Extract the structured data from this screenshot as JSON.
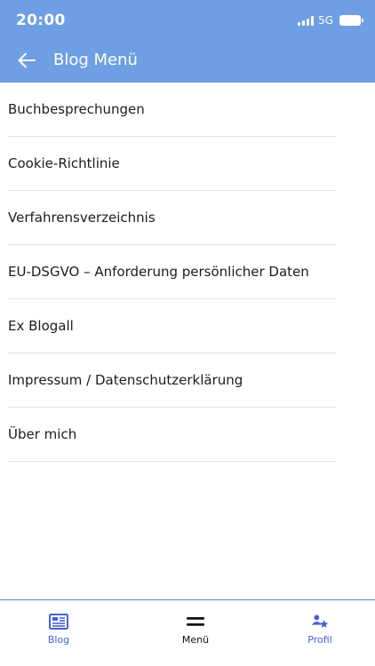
{
  "status": {
    "time": "20:00",
    "network": "5G"
  },
  "header": {
    "title": "Blog Menü",
    "back_icon": "arrow-left-icon"
  },
  "menu_items": [
    {
      "label": "Buchbesprechungen"
    },
    {
      "label": "Cookie-Richtlinie"
    },
    {
      "label": "Verfahrensverzeichnis"
    },
    {
      "label": "EU-DSGVO – Anforderung persönlicher Daten"
    },
    {
      "label": "Ex Blogall"
    },
    {
      "label": "Impressum / Datenschutzerklärung"
    },
    {
      "label": "Über mich"
    }
  ],
  "bottom_nav": {
    "blog": {
      "label": "Blog",
      "icon": "newspaper-icon"
    },
    "menu": {
      "label": "Menü",
      "icon": "menu-icon"
    },
    "profil": {
      "label": "Profil",
      "icon": "users-icon"
    }
  },
  "colors": {
    "header_bg": "#6e9ee3",
    "accent": "#4660d6",
    "divider": "#e3e3e3"
  }
}
